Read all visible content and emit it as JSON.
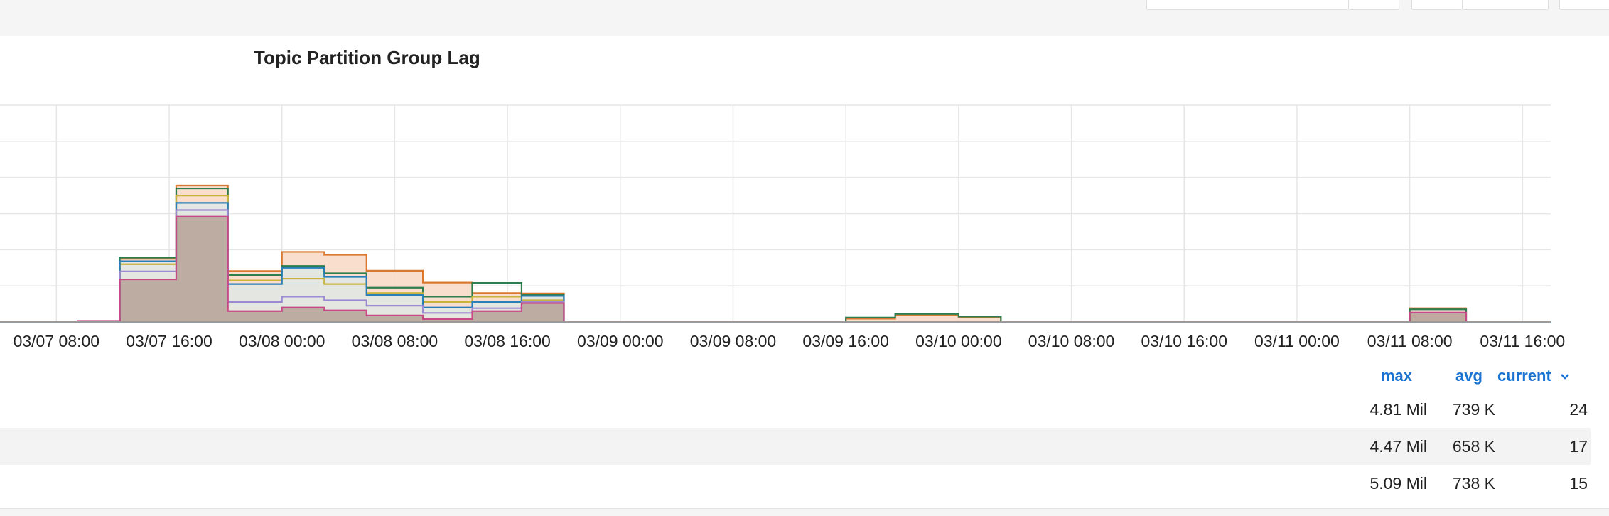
{
  "chart_data": {
    "type": "area",
    "title": "Topic Partition Group Lag",
    "x_tick_labels": [
      "03/07 08:00",
      "03/07 16:00",
      "03/08 00:00",
      "03/08 08:00",
      "03/08 16:00",
      "03/09 00:00",
      "03/09 08:00",
      "03/09 16:00",
      "03/10 00:00",
      "03/10 08:00",
      "03/10 16:00",
      "03/11 00:00",
      "03/11 08:00",
      "03/11 16:00"
    ],
    "x_range": [
      "03/07 04:00",
      "03/11 18:00"
    ],
    "interpolation": "step",
    "gridlines": true,
    "series": [
      {
        "color": "#d9782f",
        "fill": "#f8d8c4",
        "points": [
          [
            "03/07 09:30",
            0.01
          ],
          [
            "03/07 12:30",
            1.75
          ],
          [
            "03/07 16:30",
            3.78
          ],
          [
            "03/07 20:10",
            1.41
          ],
          [
            "03/08 00:00",
            1.94
          ],
          [
            "03/08 03:00",
            1.86
          ],
          [
            "03/08 06:00",
            1.42
          ],
          [
            "03/08 10:00",
            1.09
          ],
          [
            "03/08 13:30",
            0.8
          ],
          [
            "03/08 17:00",
            0.79
          ],
          [
            "03/08 20:00",
            0
          ],
          [
            "03/09 16:00",
            0.09
          ],
          [
            "03/09 19:30",
            0.18
          ],
          [
            "03/10 00:00",
            0.14
          ],
          [
            "03/10 03:00",
            0
          ],
          [
            "03/11 08:00",
            0.38
          ],
          [
            "03/11 12:00",
            0
          ]
        ]
      },
      {
        "color": "#2e7d4f",
        "fill": "none",
        "points": [
          [
            "03/07 12:30",
            1.78
          ],
          [
            "03/07 16:30",
            3.7
          ],
          [
            "03/07 20:10",
            1.3
          ],
          [
            "03/08 00:00",
            1.55
          ],
          [
            "03/08 03:00",
            1.35
          ],
          [
            "03/08 06:00",
            0.95
          ],
          [
            "03/08 10:00",
            0.7
          ],
          [
            "03/08 13:30",
            1.08
          ],
          [
            "03/08 17:00",
            0.75
          ],
          [
            "03/08 20:00",
            0
          ],
          [
            "03/09 16:00",
            0.12
          ],
          [
            "03/09 19:30",
            0.22
          ],
          [
            "03/10 00:00",
            0.15
          ],
          [
            "03/10 03:00",
            0
          ],
          [
            "03/11 08:00",
            0.35
          ],
          [
            "03/11 12:00",
            0
          ]
        ]
      },
      {
        "color": "#c9b33a",
        "fill": "none",
        "points": [
          [
            "03/07 12:30",
            1.6
          ],
          [
            "03/07 16:30",
            3.5
          ],
          [
            "03/07 20:10",
            1.15
          ],
          [
            "03/08 00:00",
            1.2
          ],
          [
            "03/08 03:00",
            1.05
          ],
          [
            "03/08 06:00",
            0.8
          ],
          [
            "03/08 10:00",
            0.55
          ],
          [
            "03/08 13:30",
            0.7
          ],
          [
            "03/08 17:00",
            0.6
          ],
          [
            "03/08 20:00",
            0
          ]
        ]
      },
      {
        "color": "#2a7fb8",
        "fill": "#dfe8e4",
        "points": [
          [
            "03/07 12:30",
            1.68
          ],
          [
            "03/07 16:30",
            3.3
          ],
          [
            "03/07 20:10",
            1.05
          ],
          [
            "03/08 00:00",
            1.5
          ],
          [
            "03/08 03:00",
            1.25
          ],
          [
            "03/08 06:00",
            0.75
          ],
          [
            "03/08 10:00",
            0.4
          ],
          [
            "03/08 13:30",
            0.55
          ],
          [
            "03/08 17:00",
            0.72
          ],
          [
            "03/08 20:00",
            0
          ]
        ]
      },
      {
        "color": "#9c8ad2",
        "fill": "none",
        "points": [
          [
            "03/07 12:30",
            1.4
          ],
          [
            "03/07 16:30",
            3.1
          ],
          [
            "03/07 20:10",
            0.55
          ],
          [
            "03/08 00:00",
            0.7
          ],
          [
            "03/08 03:00",
            0.6
          ],
          [
            "03/08 06:00",
            0.45
          ],
          [
            "03/08 10:00",
            0.25
          ],
          [
            "03/08 13:30",
            0.38
          ],
          [
            "03/08 17:00",
            0.55
          ],
          [
            "03/08 20:00",
            0
          ]
        ]
      },
      {
        "color": "#c74a86",
        "fill": "#b5a196",
        "points": [
          [
            "03/07 09:30",
            0.03
          ],
          [
            "03/07 12:30",
            1.18
          ],
          [
            "03/07 16:30",
            2.92
          ],
          [
            "03/07 20:10",
            0.3
          ],
          [
            "03/08 00:00",
            0.4
          ],
          [
            "03/08 03:00",
            0.32
          ],
          [
            "03/08 06:00",
            0.18
          ],
          [
            "03/08 10:00",
            0.08
          ],
          [
            "03/08 13:30",
            0.3
          ],
          [
            "03/08 17:00",
            0.52
          ],
          [
            "03/08 20:00",
            0
          ],
          [
            "03/11 08:00",
            0.26
          ],
          [
            "03/11 12:00",
            0
          ]
        ]
      }
    ]
  },
  "legend": {
    "headers": {
      "max": "max",
      "avg": "avg",
      "current": "current"
    },
    "rows": [
      {
        "max": "4.81 Mil",
        "avg": "739 K",
        "current": "24"
      },
      {
        "max": "4.47 Mil",
        "avg": "658 K",
        "current": "17"
      },
      {
        "max": "5.09 Mil",
        "avg": "738 K",
        "current": "15"
      }
    ]
  },
  "colors": {
    "accent": "#1a73d0",
    "grid": "#e6e6e6"
  },
  "icons": {
    "sort": "chevron-down-icon"
  }
}
